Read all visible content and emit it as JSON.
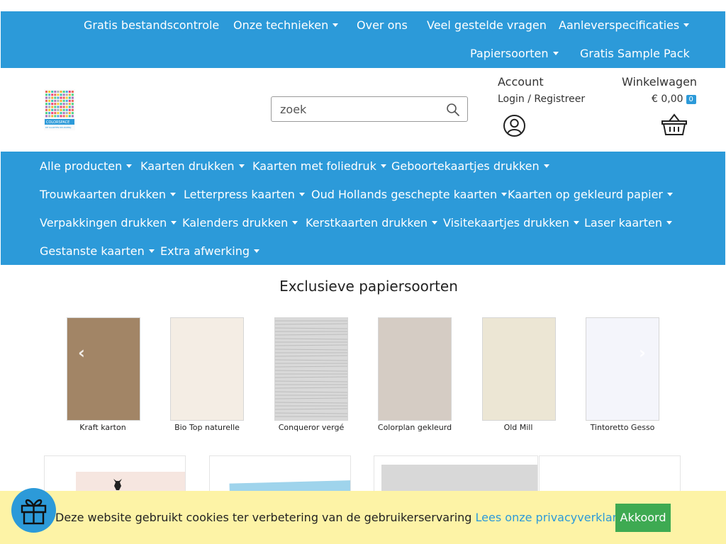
{
  "top_nav": {
    "items": [
      {
        "label": "Gratis bestandscontrole",
        "dropdown": false
      },
      {
        "label": "Onze technieken",
        "dropdown": true
      },
      {
        "label": "Over ons",
        "dropdown": false
      },
      {
        "label": "Veel gestelde vragen",
        "dropdown": false
      },
      {
        "label": "Aanleverspecificaties",
        "dropdown": true
      },
      {
        "label": "Papiersoorten",
        "dropdown": true
      },
      {
        "label": "Gratis Sample Pack",
        "dropdown": false
      }
    ]
  },
  "header": {
    "logo_text": "COLORSPACE",
    "logo_subtext": "DE KAARTEN DRUKKERIJ",
    "search_placeholder": "zoek",
    "account_title": "Account",
    "account_links": "Login / Registreer",
    "cart_title": "Winkelwagen",
    "cart_total": "€ 0,00",
    "cart_count": "0"
  },
  "category_nav": {
    "items": [
      "Alle producten",
      "Kaarten drukken",
      "Kaarten met foliedruk",
      "Geboortekaartjes drukken",
      "Trouwkaarten drukken",
      "Letterpress kaarten",
      "Oud Hollands geschepte kaarten",
      "Kaarten op gekleurd papier",
      "Verpakkingen drukken",
      "Kalenders drukken",
      "Kerstkaarten drukken",
      "Visitekaartjes drukken",
      "Laser kaarten",
      "Gestanste kaarten",
      "Extra afwerking"
    ]
  },
  "papers": {
    "title": "Exclusieve papiersoorten",
    "items": [
      {
        "name": "Kraft karton",
        "color": "#a28566"
      },
      {
        "name": "Bio Top naturelle",
        "color": "#f4ede4"
      },
      {
        "name": "Conqueror vergé",
        "color": "#d9d9d9"
      },
      {
        "name": "Colorplan gekleurd",
        "color": "#d5ccc4"
      },
      {
        "name": "Old Mill",
        "color": "#ece6d4"
      },
      {
        "name": "Tintoretto Gesso",
        "color": "#f4f5fb"
      }
    ]
  },
  "cookie": {
    "text": "Deze website gebruikt cookies ter verbetering van de gebruikerservaring",
    "link": "Lees onze privacyverklaring hier.",
    "accept": "Akkoord"
  },
  "colors": {
    "brand_blue": "#2c9ad9",
    "cookie_bg": "#fdf3a6",
    "accept_green": "#3eaa52"
  }
}
